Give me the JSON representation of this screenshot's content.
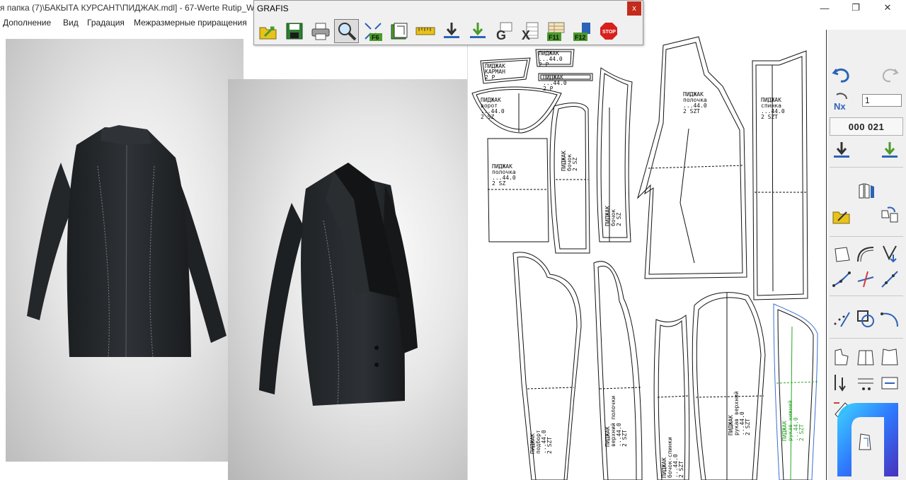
{
  "window": {
    "title": "я папка (7)\\БАКЫТА КУРСАНТ\\ПИДЖАК.mdl] - 67-Werte Rutip_W",
    "minimize_glyph": "—",
    "maximize_glyph": "❐",
    "close_glyph": "✕"
  },
  "menu": {
    "items": [
      "Дополнение",
      "Вид",
      "Градация",
      "Межразмерные приращения"
    ]
  },
  "grafis_toolbar": {
    "title": "GRAFIS",
    "close_glyph": "x",
    "tools": [
      {
        "icon": "open-folder-icon",
        "label": ""
      },
      {
        "icon": "save-icon",
        "label": ""
      },
      {
        "icon": "print-icon",
        "label": ""
      },
      {
        "icon": "zoom-icon",
        "label": "",
        "active": true
      },
      {
        "icon": "fit-view-icon",
        "label": "F6"
      },
      {
        "icon": "layer-icon",
        "label": ""
      },
      {
        "icon": "measure-tape-icon",
        "label": ""
      },
      {
        "icon": "download-arrow-icon",
        "label": ""
      },
      {
        "icon": "download-green-icon",
        "label": ""
      },
      {
        "icon": "g-icon",
        "label": "G"
      },
      {
        "icon": "x-table-icon",
        "label": "X"
      },
      {
        "icon": "f11-table-icon",
        "label": "F11"
      },
      {
        "icon": "f12-export-icon",
        "label": "F12"
      },
      {
        "icon": "stop-icon",
        "label": "STOP"
      }
    ],
    "colors": {
      "green": "#4a9a2a",
      "yellow": "#e8c21a",
      "stop": "#d8201c",
      "blue": "#2c63b8"
    }
  },
  "pattern_labels": [
    {
      "id": "pocket",
      "text": "ПИДЖАК\nКАРМАН\n2 Р"
    },
    {
      "id": "welt",
      "text": "ПИДЖАК\n...44.0\n2 Р"
    },
    {
      "id": "flap",
      "text": "ПИДЖАК\n...44.0\n2 Р"
    },
    {
      "id": "collar",
      "text": "ПИДЖАК\nворот\n...44.0\n2 SZ"
    },
    {
      "id": "back-half",
      "text": "ПИДЖАК\nполочка\n...44.0\n2 SZ"
    },
    {
      "id": "side-front",
      "text": "ПИДЖАК\nбочок\n2 SZ"
    },
    {
      "id": "side-panel",
      "text": "ПИДЖАК\nбочок\n2 SZ"
    },
    {
      "id": "front",
      "text": "ПИДЖАК\nполочка\n...44.0\n2 SZT"
    },
    {
      "id": "back",
      "text": "ПИДЖАК\nспинка\n...44.0\n2 SZT"
    },
    {
      "id": "sleeve-upper-a",
      "text": "ПИДЖАК\nподборт\n...44.0\n2 SZT"
    },
    {
      "id": "sleeve-upper-b",
      "text": "ПИДЖАК\nверхний полочки\n...44.0\n2 SZT"
    },
    {
      "id": "lining-side",
      "text": "ПИДЖАК\nбочок-спинки\n...44.0\n2 SZT"
    },
    {
      "id": "sleeve-top",
      "text": "ПИДЖАК\nрукав верхний\n...44.0\n2 SZT"
    },
    {
      "id": "sleeve-under",
      "text": "ПИДЖАК\nрукав нижний\n...44.0\n2 SZT",
      "green": true
    }
  ],
  "right_panel": {
    "counter_value": "1",
    "piece_number": "000 021",
    "colors": {
      "blue": "#2c63b8",
      "green": "#4a9a2a",
      "red": "#d63a3a"
    }
  }
}
